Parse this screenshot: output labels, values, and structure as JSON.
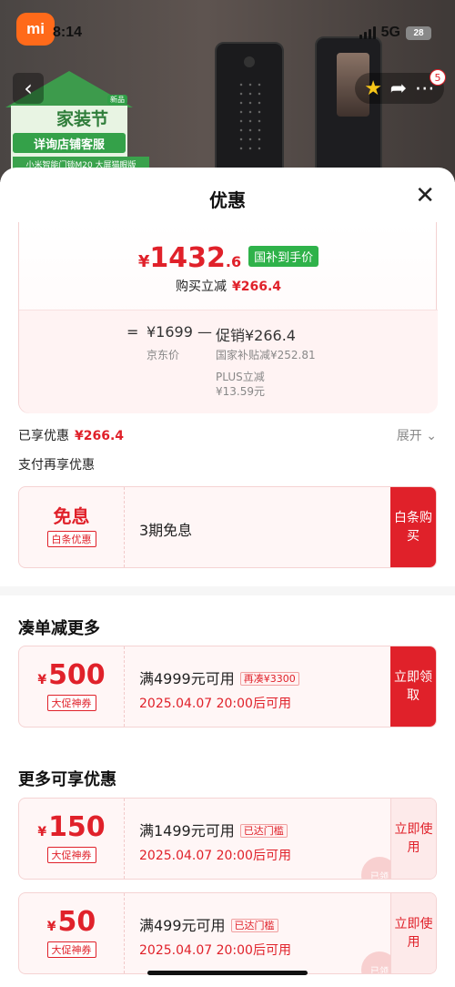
{
  "status_bar": {
    "time": "8:14",
    "network": "5G",
    "battery": "28"
  },
  "banner": {
    "brand": "mi",
    "festival": "家装节",
    "festival_tag": "新品",
    "cs_text": "详询店铺客服",
    "sub_text": "小米智能门锁M20 大屏猫眼版",
    "cart_badge": "5"
  },
  "sheet": {
    "title": "优惠",
    "price": {
      "currency": "¥",
      "int": "1432",
      "dec": ".6",
      "tag": "国补到手价"
    },
    "buy_reduce_label": "购买立减",
    "buy_reduce_value": "¥266.4",
    "calc": {
      "eq": "=",
      "jd_price": "¥1699",
      "minus": "—",
      "promo": "促销¥266.4",
      "jd_label": "京东价",
      "national": "国家补贴减¥252.81",
      "plus_label": "PLUS立减",
      "plus_value": "¥13.59元"
    },
    "enjoyed_label": "已享优惠",
    "enjoyed_value": "¥266.4",
    "expand_label": "展开",
    "pay_more_label": "支付再享优惠",
    "installment": {
      "title": "免息",
      "tag": "白条优惠",
      "desc": "3期免息",
      "action": "白条购买"
    }
  },
  "sections": {
    "bundle_title": "凑单减更多",
    "more_title": "更多可享优惠"
  },
  "coupons": [
    {
      "currency": "¥",
      "amount": "500",
      "tag": "大促神券",
      "condition": "满4999元可用",
      "mini_tag": "再凑¥3300",
      "date": "2025.04.07 20:00后可用",
      "action": "立即领取"
    },
    {
      "currency": "¥",
      "amount": "150",
      "tag": "大促神券",
      "condition": "满1499元可用",
      "mini_tag": "已达门槛",
      "date": "2025.04.07 20:00后可用",
      "action": "立即使用"
    },
    {
      "currency": "¥",
      "amount": "50",
      "tag": "大促神券",
      "condition": "满499元可用",
      "mini_tag": "已达门槛",
      "date": "2025.04.07 20:00后可用",
      "action": "立即使用"
    }
  ],
  "stamp_text": "已领",
  "colors": {
    "accent": "#e0212a",
    "green": "#2fb24a"
  }
}
